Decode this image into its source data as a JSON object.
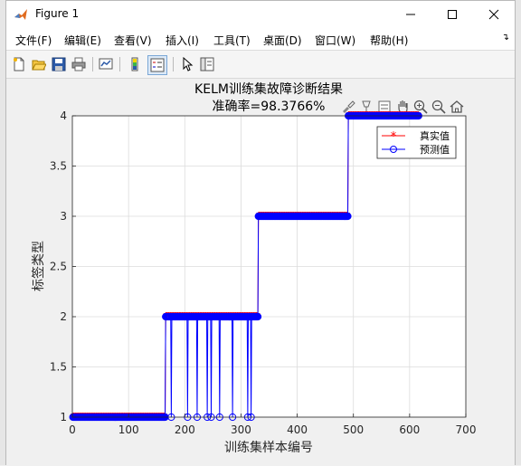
{
  "window": {
    "title": "Figure 1"
  },
  "menu": [
    "文件(F)",
    "编辑(E)",
    "查看(V)",
    "插入(I)",
    "工具(T)",
    "桌面(D)",
    "窗口(W)",
    "帮助(H)"
  ],
  "toolbar": [
    "new-figure-icon",
    "open-icon",
    "save-icon",
    "print-icon",
    "link-plot-icon",
    "colorbar-icon",
    "legend-icon",
    "edit-plot-icon",
    "property-inspector-icon"
  ],
  "axes_toolbar": [
    "brush-icon",
    "data-tip-icon",
    "restore-icon",
    "pan-icon",
    "zoom-in-icon",
    "zoom-out-icon",
    "home-icon"
  ],
  "colors": {
    "true_series": "#ff0000",
    "pred_series": "#0000ff"
  },
  "chart_data": {
    "type": "line",
    "title": "KELM训练集故障诊断结果",
    "subtitle": "准确率=98.3766%",
    "xlabel": "训练集样本编号",
    "ylabel": "标签类型",
    "xlim": [
      0,
      700
    ],
    "ylim": [
      1,
      4
    ],
    "xticks": [
      "0",
      "100",
      "200",
      "300",
      "400",
      "500",
      "600",
      "700"
    ],
    "yticks": [
      "1",
      "1.5",
      "2",
      "2.5",
      "3",
      "3.5",
      "4"
    ],
    "grid": true,
    "legend_position": "top-right",
    "series": [
      {
        "name": "真实值",
        "marker": "*",
        "color": "#ff0000",
        "segments": [
          {
            "from": 1,
            "to": 165,
            "value": 1
          },
          {
            "from": 166,
            "to": 330,
            "value": 2
          },
          {
            "from": 331,
            "to": 490,
            "value": 3
          },
          {
            "from": 491,
            "to": 616,
            "value": 4
          }
        ]
      },
      {
        "name": "预测值",
        "marker": "o",
        "color": "#0000ff",
        "segments": [
          {
            "from": 1,
            "to": 165,
            "value": 1
          },
          {
            "from": 166,
            "to": 330,
            "value": 2
          },
          {
            "from": 331,
            "to": 490,
            "value": 3
          },
          {
            "from": 491,
            "to": 616,
            "value": 4
          }
        ],
        "misclassified": [
          {
            "x": 176,
            "value": 1
          },
          {
            "x": 205,
            "value": 1
          },
          {
            "x": 222,
            "value": 1
          },
          {
            "x": 240,
            "value": 1
          },
          {
            "x": 247,
            "value": 1
          },
          {
            "x": 262,
            "value": 1
          },
          {
            "x": 285,
            "value": 1
          },
          {
            "x": 312,
            "value": 1
          },
          {
            "x": 318,
            "value": 1
          }
        ]
      }
    ]
  }
}
